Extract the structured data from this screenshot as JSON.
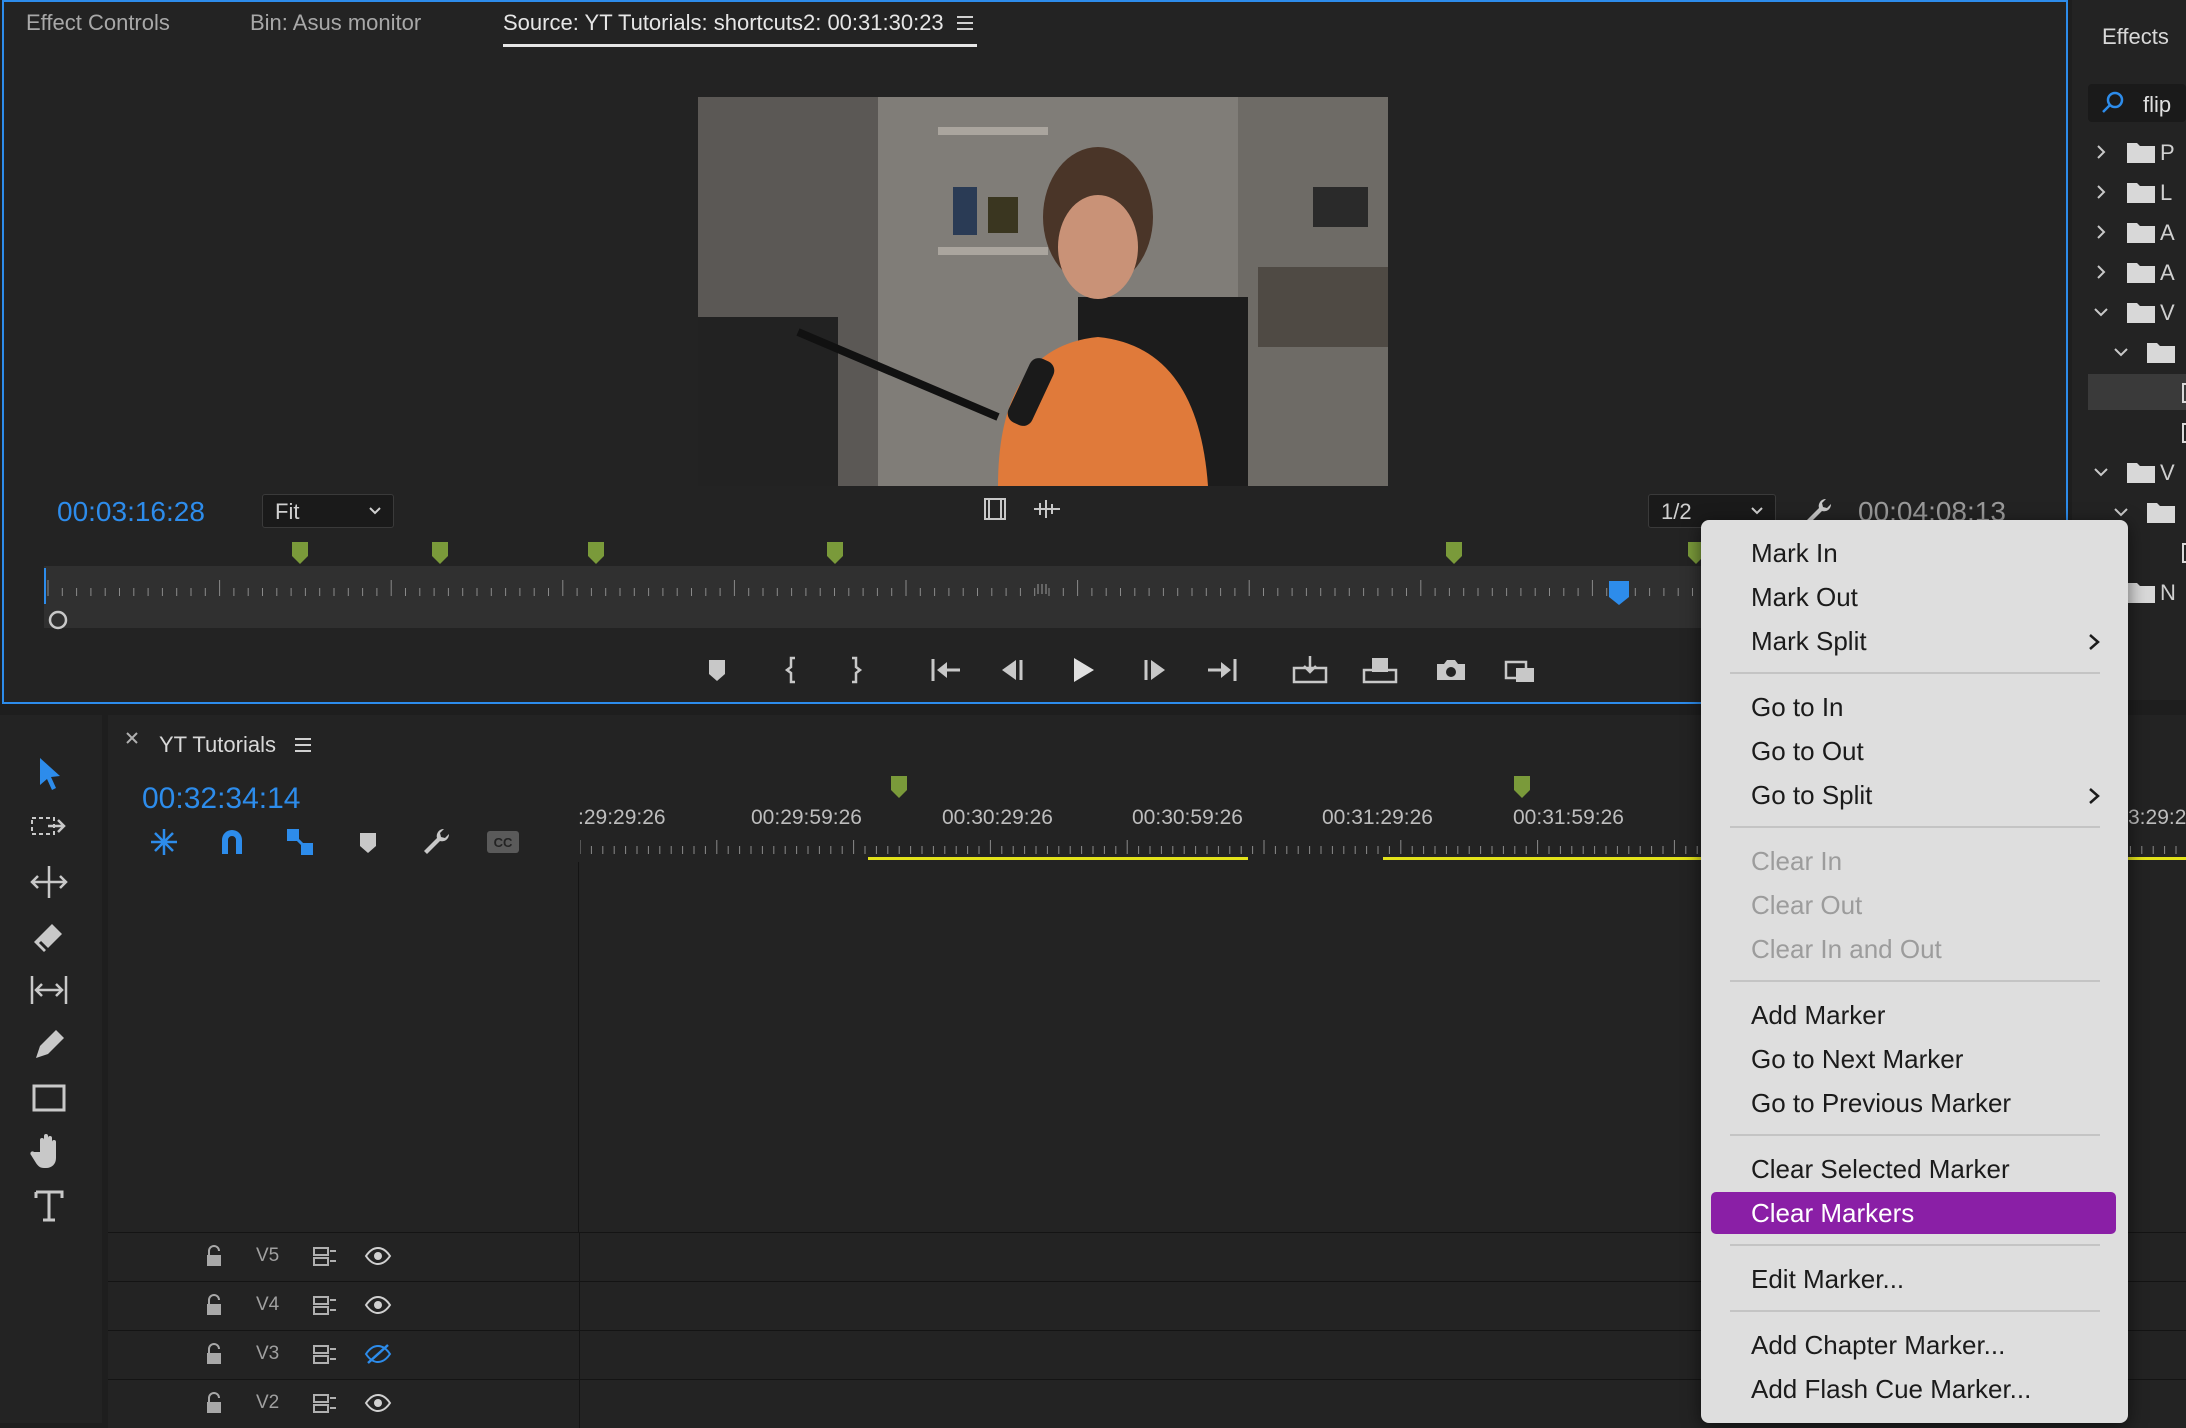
{
  "source_panel": {
    "tabs": [
      {
        "label": "Effect Controls"
      },
      {
        "label": "Bin: Asus monitor"
      },
      {
        "label": "Source: YT Tutorials: shortcuts2: 00:31:30:23"
      }
    ],
    "current_timecode": "00:03:16:28",
    "zoom_select": "Fit",
    "resolution_select": "1/2",
    "duration_timecode": "00:04:08:13"
  },
  "timeline": {
    "tab_label": "YT Tutorials",
    "current_timecode": "00:32:34:14",
    "ruler_labels": [
      ":29:29:26",
      "00:29:59:26",
      "00:30:29:26",
      "00:30:59:26",
      "00:31:29:26",
      "00:31:59:26",
      "3:29:2"
    ],
    "tracks": [
      {
        "label": "V5",
        "visible": true
      },
      {
        "label": "V4",
        "visible": true
      },
      {
        "label": "V3",
        "visible": false
      },
      {
        "label": "V2",
        "visible": true
      }
    ]
  },
  "effects": {
    "title": "Effects",
    "search_value": "flip",
    "rows": [
      "P",
      "L",
      "A",
      "A",
      "V",
      "",
      "",
      "",
      "V",
      "",
      "",
      "N"
    ]
  },
  "context_menu": {
    "items": [
      {
        "label": "Mark In"
      },
      {
        "label": "Mark Out"
      },
      {
        "label": "Mark Split"
      },
      {
        "label": "Go to In"
      },
      {
        "label": "Go to Out"
      },
      {
        "label": "Go to Split"
      },
      {
        "label": "Clear In"
      },
      {
        "label": "Clear Out"
      },
      {
        "label": "Clear In and Out"
      },
      {
        "label": "Add Marker"
      },
      {
        "label": "Go to Next Marker"
      },
      {
        "label": "Go to Previous Marker"
      },
      {
        "label": "Clear Selected Marker"
      },
      {
        "label": "Clear Markers"
      },
      {
        "label": "Edit Marker..."
      },
      {
        "label": "Add Chapter Marker..."
      },
      {
        "label": "Add Flash Cue Marker..."
      }
    ]
  },
  "colors": {
    "accent_blue": "#2d8ceb",
    "marker_green": "#7a9a3a",
    "menu_highlight": "#8a1fa6",
    "inout_yellow": "#e2e21a"
  }
}
